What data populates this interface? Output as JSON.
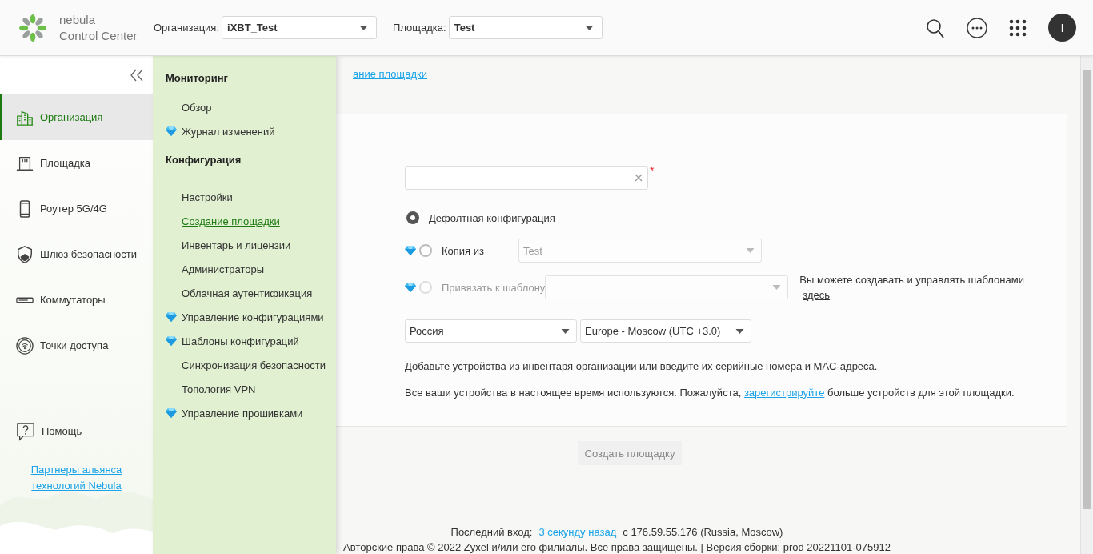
{
  "header": {
    "logo": {
      "line1": "nebula",
      "line2": "Control Center"
    },
    "org_select": {
      "label": "Организация:",
      "value": "iXBT_Test"
    },
    "site_select": {
      "label": "Площадка:",
      "value": "Test"
    },
    "avatar": "I"
  },
  "sidebar": {
    "items": [
      {
        "label": "Организация",
        "selected": true
      },
      {
        "label": "Площадка",
        "selected": false
      },
      {
        "label": "Роутер 5G/4G",
        "selected": false
      },
      {
        "label": "Шлюз безопасности",
        "selected": false
      },
      {
        "label": "Коммутаторы",
        "selected": false
      },
      {
        "label": "Точки доступа",
        "selected": false
      }
    ],
    "help": "Помощь",
    "partner_link": "Партнеры альянса технологий Nebula"
  },
  "menu": {
    "sections": [
      {
        "title": "Мониторинг",
        "items": [
          {
            "label": "Обзор",
            "premium": false,
            "selected": false
          },
          {
            "label": "Журнал изменений",
            "premium": true,
            "selected": false
          }
        ]
      },
      {
        "title": "Конфигурация",
        "items": [
          {
            "label": "Настройки",
            "premium": false,
            "selected": false
          },
          {
            "label": "Создание площадки",
            "premium": false,
            "selected": true
          },
          {
            "label": "Инвентарь и лицензии",
            "premium": false,
            "selected": false
          },
          {
            "label": "Администраторы",
            "premium": false,
            "selected": false
          },
          {
            "label": "Облачная аутентификация",
            "premium": false,
            "selected": false
          },
          {
            "label": "Управление конфигурациями",
            "premium": true,
            "selected": false
          },
          {
            "label": "Шаблоны конфигураций",
            "premium": true,
            "selected": false
          },
          {
            "label": "Синхронизация безопасности",
            "premium": false,
            "selected": false
          },
          {
            "label": "Топология VPN",
            "premium": false,
            "selected": false
          },
          {
            "label": "Управление прошивками",
            "premium": true,
            "selected": false
          }
        ]
      }
    ]
  },
  "breadcrumb": {
    "current": "ание площадки"
  },
  "form": {
    "name_field": {
      "required": true,
      "required_mark": "*"
    },
    "options": [
      {
        "label": "Дефолтная конфигурация",
        "selected": true,
        "premium": false,
        "disabled": false
      },
      {
        "label": "Копия из",
        "selected": false,
        "premium": true,
        "disabled": false,
        "select": {
          "value": "Test",
          "disabled": true
        }
      },
      {
        "label": "Привязать к шаблону",
        "selected": false,
        "premium": true,
        "disabled": true,
        "select": {
          "disabled": true
        },
        "note": "Вы можете создавать и управлять шаблонами",
        "note_link": "здесь"
      }
    ],
    "country": {
      "value": "Россия"
    },
    "timezone": {
      "value": "Europe - Moscow (UTC +3.0)"
    },
    "info": "Добавьте устройства из инвентаря организации или введите их серийные номера и MAC-адреса.",
    "notice": {
      "before": "Все ваши устройства в настоящее время используются. Пожалуйста, ",
      "link": "зарегистрируйте",
      "after": " больше устройств для этой площадки."
    },
    "submit": {
      "label": "Создать площадку",
      "disabled": true
    }
  },
  "footer": {
    "last_login_label": "Последний вход:",
    "last_login_time": "3 секунду назад",
    "last_login_from": "с 176.59.55.176 (Russia, Moscow)",
    "copyright": "Авторские права © 2022 Zyxel и/или его филиалы. Все права защищены. | Версия сборки: prod 20221101-075912"
  }
}
